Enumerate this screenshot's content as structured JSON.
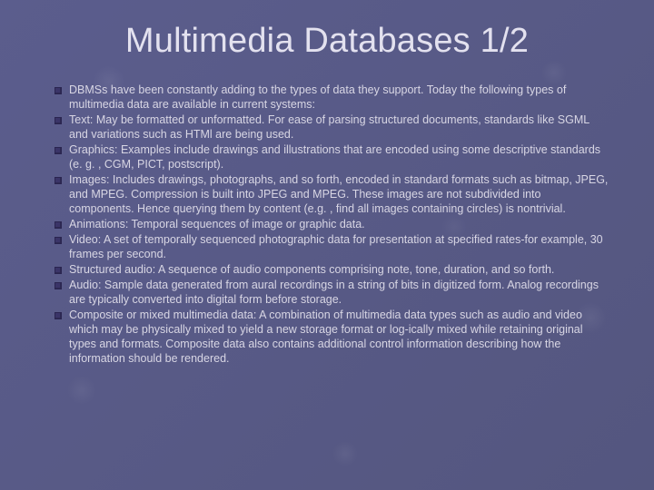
{
  "slide": {
    "title": "Multimedia Databases 1/2",
    "bullets": [
      "DBMSs have been constantly adding to the types of data they support. Today the following types of multimedia data are available in current systems:",
      "Text: May be formatted or unformatted. For ease of parsing structured documents, standards like SGML and variations such as HTMl are being used.",
      "Graphics: Examples include drawings and illustrations that are encoded using some descriptive standards (e. g. , CGM, PICT, postscript).",
      "Images: Includes drawings, photographs, and so forth, encoded in standard formats such as bitmap, JPEG, and MPEG. Compression is built into JPEG and MPEG. These images are not subdivided into components. Hence querying them by content (e.g. , find all images containing circles) is nontrivial.",
      "Animations: Temporal sequences of image or graphic data.",
      "Video: A set of temporally sequenced photographic data for presentation at specified rates-for example, 30 frames per second.",
      "Structured audio: A sequence of audio components comprising note, tone, duration, and so forth.",
      "Audio: Sample data generated from aural recordings in a string of bits in digitized form. Analog recordings are typically converted into digital form before storage.",
      "Composite or mixed multimedia data: A combination of multimedia data types such as audio and video which may be physically mixed to yield a new storage format or log-ically mixed while retaining original types and formats. Composite data also contains additional control information describing how the information should be rendered."
    ]
  }
}
